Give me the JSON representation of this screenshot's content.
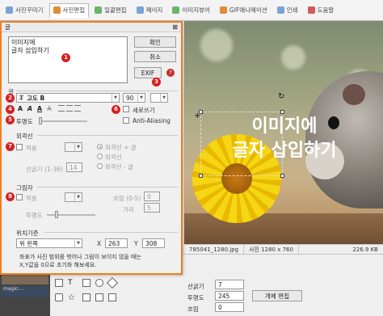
{
  "tabs": [
    {
      "label": "사진꾸미기"
    },
    {
      "label": "사진편집"
    },
    {
      "label": "일괄편집"
    },
    {
      "label": "페이지"
    },
    {
      "label": "이미지뷰어"
    },
    {
      "label": "GIF애니메이션"
    },
    {
      "label": "인쇄"
    },
    {
      "label": "도움말"
    }
  ],
  "dialog": {
    "title": "글",
    "text_value": "이미지에\n글자 삽입하기",
    "ok_label": "확인",
    "cancel_label": "취소",
    "exif_label": "EXIF",
    "help_icon": "help-icon",
    "close_icon": "close-icon",
    "group_text_label": "글",
    "font_name": "고도 B",
    "font_size": "90",
    "format_buttons": [
      "A",
      "A",
      "A",
      "A"
    ],
    "vertical_label": "세로쓰기",
    "transparency_label": "투명도",
    "antialias_label": "Anti-Aliasing",
    "outline": {
      "group_label": "외곽선",
      "apply_label": "적용",
      "thickness_label": "선굵기 (1-36)",
      "thickness_value": "14",
      "opt_outline_text": "외곽선 + 글",
      "opt_outline": "외곽선",
      "opt_outline_minus": "외곽선 - 글"
    },
    "shadow": {
      "group_label": "그림자",
      "apply_label": "적용",
      "blur_label": "흐림 (0-5)",
      "blur_value": "0",
      "distance_label": "거리",
      "distance_value": "5",
      "transparency_label": "투명도"
    },
    "position": {
      "group_label": "위치기준",
      "anchor_value": "위 왼쪽",
      "x_label": "X",
      "x_value": "263",
      "y_label": "Y",
      "y_value": "308",
      "hint": "좌표가 사진 범위를 벗어나 그림이 보이지 않을 때는\nX,Y값을 0으로 초기화 해보세요."
    },
    "badges": [
      "1",
      "2",
      "3",
      "4",
      "5",
      "6",
      "7",
      "8"
    ]
  },
  "canvas": {
    "overlay_line1": "이미지에",
    "overlay_line2": "글자 삽입하기"
  },
  "status": {
    "filename": "785041_1280.jpg",
    "photo_size": "사진 1280 x 760",
    "file_size": "226.9 KB"
  },
  "bottom": {
    "line_thickness_label": "선굵기",
    "line_thickness_value": "7",
    "transparency_label": "투명도",
    "transparency_value": "245",
    "blur_label": "흐림",
    "blur_value": "0",
    "object_edit_label": "개체 편집",
    "thumb_label": "magic-..."
  },
  "colors": {
    "dialog_border": "#f07f1f",
    "badge": "#d81e1e"
  }
}
